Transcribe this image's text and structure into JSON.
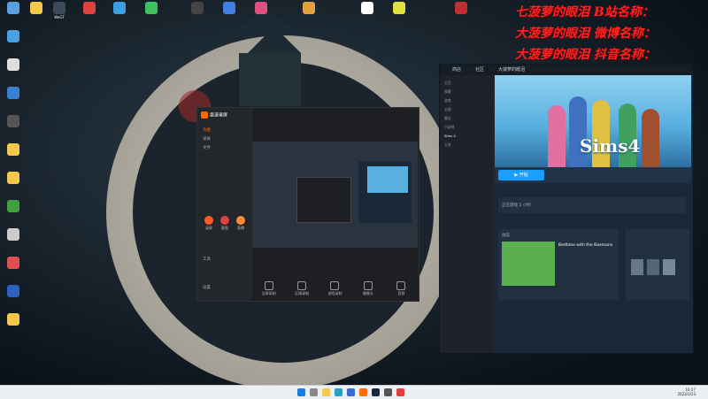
{
  "overlay": {
    "line1": "七菠萝的眼泪   B站名称：",
    "line2": "大菠萝的眼泪   微博名称：",
    "line3": "大菠萝的眼泪   抖音名称："
  },
  "desktop_icons": [
    {
      "label": "",
      "color": "#5aa0e0"
    },
    {
      "label": "",
      "color": "#f2c94c"
    },
    {
      "label": "WeGT",
      "color": "#3a4a5a"
    },
    {
      "label": "",
      "color": "#e04040"
    },
    {
      "label": "",
      "color": "#3aa0e0"
    },
    {
      "label": "",
      "color": "#40c060"
    },
    {
      "label": "",
      "color": "#444"
    },
    {
      "label": "",
      "color": "#4080e0"
    },
    {
      "label": "",
      "color": "#e05080"
    },
    {
      "label": "",
      "color": "#e0a040"
    },
    {
      "label": "",
      "color": "#fff"
    },
    {
      "label": "",
      "color": "#e0e040"
    },
    {
      "label": "",
      "color": "#c03030"
    }
  ],
  "recorder": {
    "brand": "嘉速录屏",
    "nav": [
      "功能",
      "录屏",
      "文件",
      "工具",
      "设置"
    ],
    "tools": [
      "全屏录制",
      "区域录制",
      "游戏录制",
      "摄像头",
      "音频"
    ],
    "big_buttons": [
      "录屏",
      "截图",
      "直播"
    ]
  },
  "steam": {
    "tabs": [
      "商店",
      "社区",
      "大菠萝的眼泪"
    ],
    "hero_title": "Sims4",
    "play_label": "▶ 开始",
    "library": [
      "主页",
      "收藏",
      "游戏",
      "全部",
      "最近",
      "已安装",
      "Sims 4",
      "分类"
    ],
    "friends_text": "正在游戏 5 小时",
    "news_title": "Bedtime with the Baemans",
    "activity": "动态"
  },
  "taskbar": {
    "time": "16:27",
    "date": "2023/3/23"
  }
}
